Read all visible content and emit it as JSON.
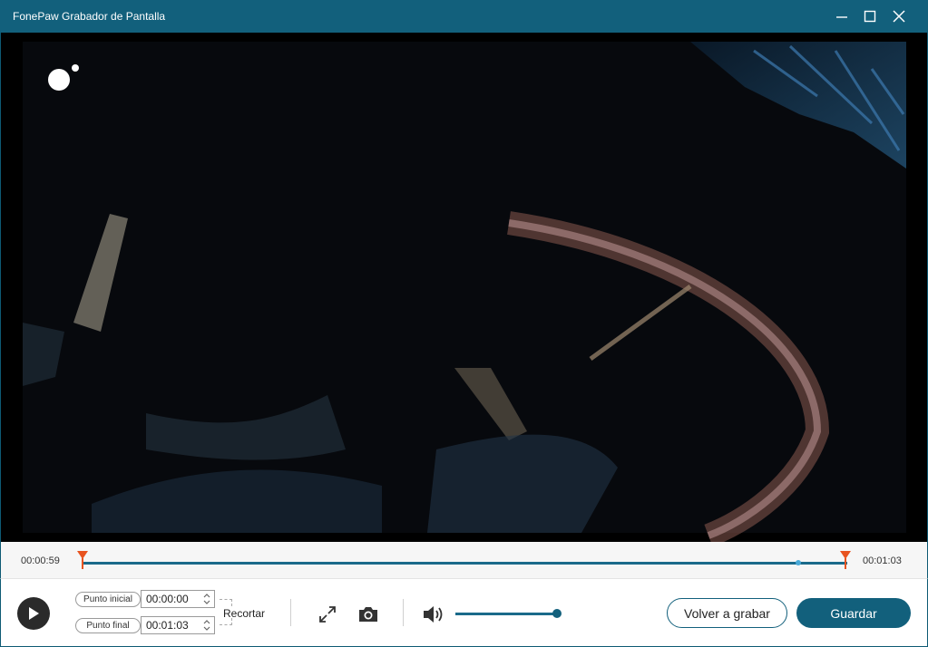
{
  "window": {
    "title": "FonePaw Grabador de Pantalla"
  },
  "icons": {
    "minimize": "minimize-icon",
    "maximize": "maximize-icon",
    "close": "close-icon",
    "play": "play-icon",
    "expand": "expand-icon",
    "screenshot": "camera-icon",
    "volume": "volume-icon",
    "logo": "dots-logo-icon"
  },
  "timeline": {
    "current_time": "00:00:59",
    "total_time": "00:01:03",
    "playhead_fraction": 0.936,
    "marker_color": "#e8531f"
  },
  "trim": {
    "start_label": "Punto inicial",
    "start_value": "00:00:00",
    "end_label": "Punto final",
    "end_value": "00:01:03",
    "trim_label": "Recortar"
  },
  "volume": {
    "level_fraction": 1.0
  },
  "actions": {
    "rerecord_label": "Volver a grabar",
    "save_label": "Guardar"
  },
  "colors": {
    "accent": "#12607c",
    "track": "#1a6a8a",
    "marker": "#e8531f",
    "playhead": "#48a9d8"
  }
}
